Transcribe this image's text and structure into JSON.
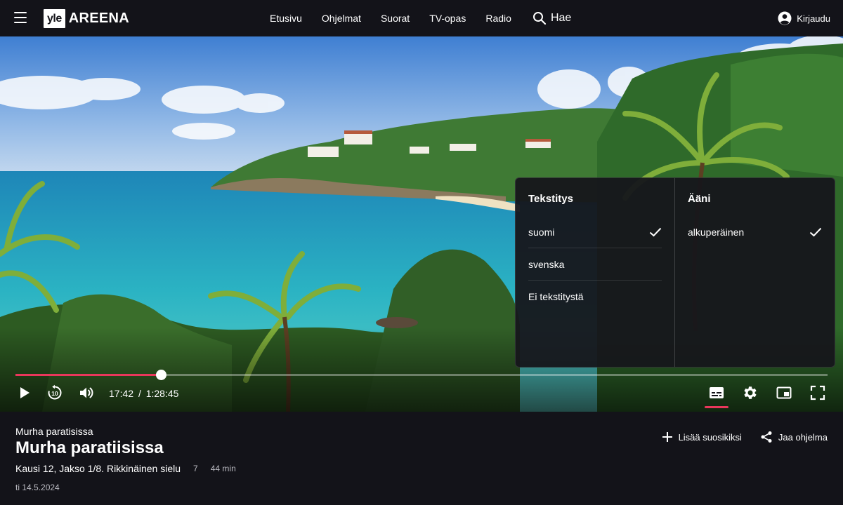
{
  "header": {
    "logo_box": "yle",
    "logo_text": "AREENA",
    "nav": [
      {
        "label": "Etusivu"
      },
      {
        "label": "Ohjelmat"
      },
      {
        "label": "Suorat"
      },
      {
        "label": "TV-opas"
      },
      {
        "label": "Radio"
      }
    ],
    "search_label": "Hae",
    "login_label": "Kirjaudu"
  },
  "player": {
    "progress_fraction": 0.179,
    "current_time": "17:42",
    "separator": "/",
    "duration": "1:28:45",
    "skip_back_seconds": "10",
    "accent_color": "#e8375b"
  },
  "settings_menu": {
    "subtitles": {
      "title": "Tekstitys",
      "options": [
        {
          "label": "suomi",
          "selected": true
        },
        {
          "label": "svenska",
          "selected": false
        },
        {
          "label": "Ei tekstitystä",
          "selected": false
        }
      ]
    },
    "audio": {
      "title": "Ääni",
      "options": [
        {
          "label": "alkuperäinen",
          "selected": true
        }
      ]
    }
  },
  "program": {
    "series_name": "Murha paratisissa",
    "title": "Murha paratiisissa",
    "episode": "Kausi 12, Jakso 1/8. Rikkinäinen sielu",
    "age_rating": "7",
    "length": "44 min",
    "date": "ti 14.5.2024"
  },
  "actions": {
    "favorite_label": "Lisää suosikiksi",
    "share_label": "Jaa ohjelma"
  }
}
